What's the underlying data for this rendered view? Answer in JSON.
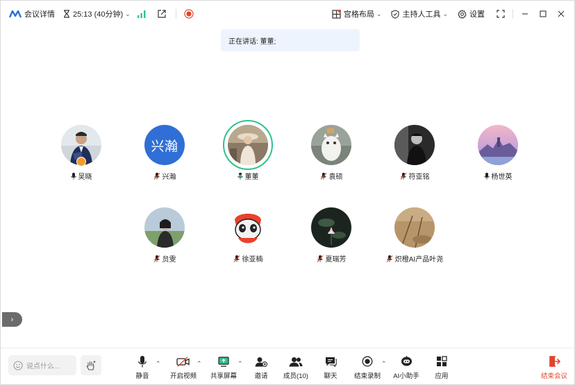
{
  "topbar": {
    "meeting_details": "会议详情",
    "timer": "25:13 (40分钟)",
    "layout_label": "宫格布局",
    "host_tools_label": "主持人工具",
    "settings_label": "设置"
  },
  "speaking_banner": "正在讲话: 董董;",
  "participants": [
    {
      "name": "吴晓",
      "mic": "on"
    },
    {
      "name": "兴瀚",
      "mic": "muted",
      "avatar_text": "兴瀚"
    },
    {
      "name": "董董",
      "mic": "on",
      "speaking": true
    },
    {
      "name": "袁硕",
      "mic": "muted"
    },
    {
      "name": "符亚铭",
      "mic": "muted"
    },
    {
      "name": "杨世英",
      "mic": "on"
    },
    {
      "name": "贠雯",
      "mic": "muted"
    },
    {
      "name": "徐亚楠",
      "mic": "muted"
    },
    {
      "name": "夏瑞芳",
      "mic": "muted"
    },
    {
      "name": "炽橙AI产品叶尧",
      "mic": "muted"
    }
  ],
  "bottombar": {
    "chat_placeholder": "说点什么...",
    "mute": "静音",
    "start_video": "开启视频",
    "share_screen": "共享屏幕",
    "invite": "邀请",
    "members": "成员(10)",
    "chat": "聊天",
    "end_recording": "结束录制",
    "ai_assistant": "AI小助手",
    "apps": "应用",
    "end_meeting": "结束会议"
  },
  "colors": {
    "accent_green": "#2fc28a",
    "record_red": "#e0442b",
    "banner_bg": "#eef4fd",
    "avatar_blue": "#2f6fd6"
  }
}
